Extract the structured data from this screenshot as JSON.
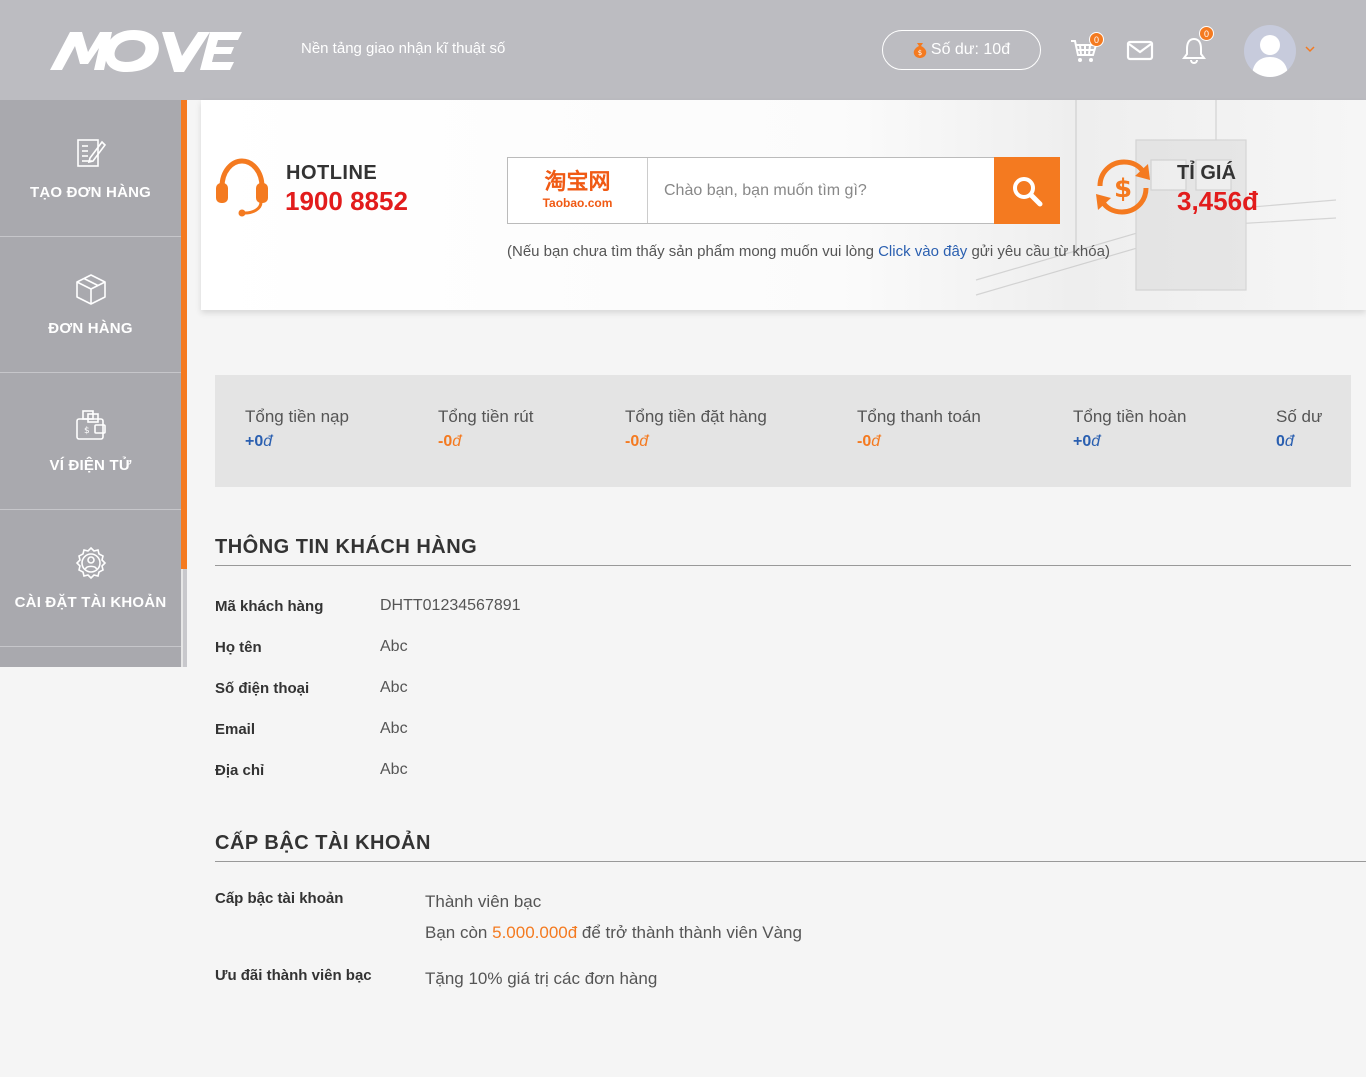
{
  "header": {
    "logo_text": "MOVE",
    "tagline": "Nền tảng giao nhận kĩ thuật số",
    "balance_label": "Số dư: 10đ",
    "cart_count": "0",
    "notification_count": "0",
    "accent_color": "#f47a20"
  },
  "sidebar": {
    "items": [
      {
        "label": "TẠO ĐƠN HÀNG",
        "icon": "edit-order-icon"
      },
      {
        "label": "ĐƠN HÀNG",
        "icon": "box-icon"
      },
      {
        "label": "VÍ ĐIỆN TỬ",
        "icon": "wallet-icon"
      },
      {
        "label": "CÀI ĐẶT TÀI KHOẢN",
        "icon": "account-settings-icon"
      }
    ]
  },
  "hero": {
    "hotline_title": "HOTLINE",
    "hotline_number": "1900 8852",
    "search_logo_cn": "淘宝网",
    "search_logo_en": "Taobao.com",
    "search_placeholder": "Chào bạn, bạn muốn tìm gì?",
    "note_prefix": "(Nếu bạn chưa tìm thấy sản phẩm mong muốn vui lòng ",
    "note_link": "Click vào đây",
    "note_suffix": " gửi yêu cầu từ khóa)",
    "rate_title": "TỈ GIÁ",
    "rate_value": "3,456đ"
  },
  "summary": {
    "items": [
      {
        "label": "Tổng tiền nạp",
        "value": "+0",
        "currency": "đ",
        "color": "#2a5fb0"
      },
      {
        "label": "Tổng tiền rút",
        "value": "-0",
        "currency": "đ",
        "color": "#f47a20"
      },
      {
        "label": "Tổng tiền đặt hàng",
        "value": "-0",
        "currency": "đ",
        "color": "#f47a20"
      },
      {
        "label": "Tổng thanh toán",
        "value": "-0",
        "currency": "đ",
        "color": "#f47a20"
      },
      {
        "label": "Tổng tiền hoàn",
        "value": "+0",
        "currency": "đ",
        "color": "#2a5fb0"
      },
      {
        "label": "Số dư",
        "value": "0",
        "currency": "đ",
        "color": "#2a5fb0"
      }
    ]
  },
  "customer": {
    "title": "THÔNG TIN KHÁCH HÀNG",
    "rows": [
      {
        "label": "Mã khách hàng",
        "value": "DHTT01234567891"
      },
      {
        "label": "Họ tên",
        "value": "Abc"
      },
      {
        "label": "Số điện thoại",
        "value": "Abc"
      },
      {
        "label": "Email",
        "value": "Abc"
      },
      {
        "label": "Địa chỉ",
        "value": "Abc"
      }
    ]
  },
  "tier": {
    "title": "CẤP BẬC TÀI KHOẢN",
    "level_label": "Cấp bậc tài khoản",
    "level_value": "Thành viên bạc",
    "next_prefix": "Bạn còn ",
    "next_amount": "5.000.000đ",
    "next_suffix": " để trở thành thành viên Vàng",
    "perk_label": "Ưu đãi thành viên bạc",
    "perk_value": "Tặng 10% giá trị các đơn hàng"
  }
}
